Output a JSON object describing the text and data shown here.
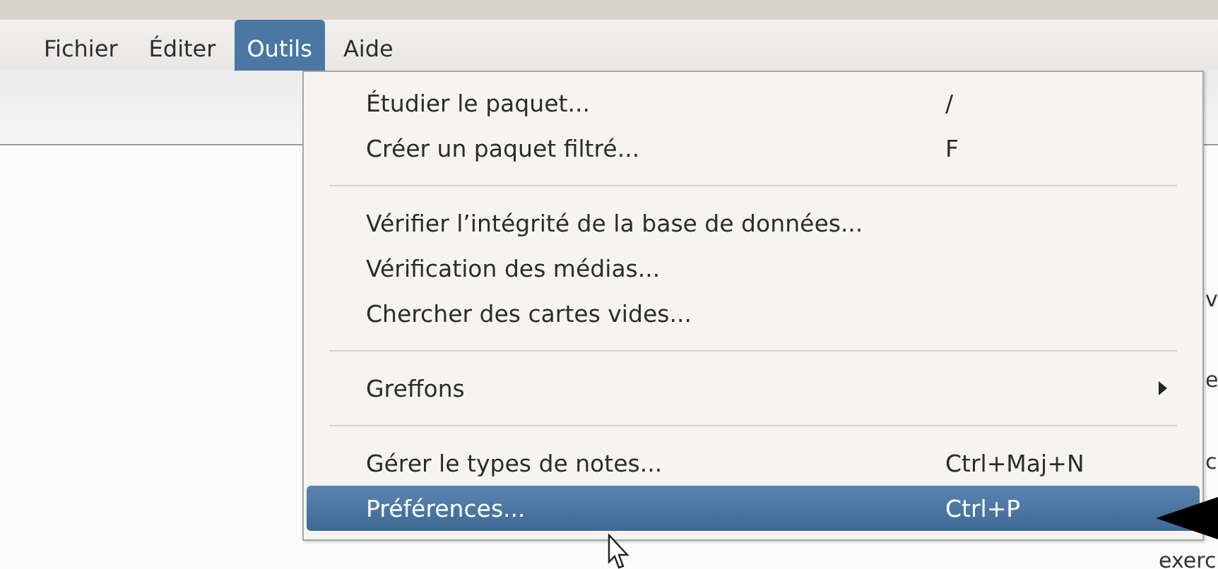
{
  "menubar": [
    {
      "label": "Fichier",
      "selected": false
    },
    {
      "label": "Éditer",
      "selected": false
    },
    {
      "label": "Outils",
      "selected": true
    },
    {
      "label": "Aide",
      "selected": false
    }
  ],
  "background_text": [
    "v",
    "e",
    "c",
    "exerc"
  ],
  "menu": {
    "items": [
      {
        "kind": "item",
        "label": "Étudier le paquet...",
        "shortcut": "/",
        "selected": false
      },
      {
        "kind": "item",
        "label": "Créer un paquet filtré...",
        "shortcut": "F",
        "selected": false
      },
      {
        "kind": "separator"
      },
      {
        "kind": "item",
        "label": "Vérifier l’intégrité de la base de données...",
        "selected": false
      },
      {
        "kind": "item",
        "label": "Vérification des médias...",
        "selected": false
      },
      {
        "kind": "item",
        "label": "Chercher des cartes vides...",
        "selected": false
      },
      {
        "kind": "separator"
      },
      {
        "kind": "submenu",
        "label": "Greffons",
        "selected": false
      },
      {
        "kind": "separator"
      },
      {
        "kind": "item",
        "label": "Gérer le types de notes...",
        "shortcut": "Ctrl+Maj+N",
        "selected": false
      },
      {
        "kind": "item",
        "label": "Préférences...",
        "shortcut": "Ctrl+P",
        "selected": true
      }
    ]
  }
}
